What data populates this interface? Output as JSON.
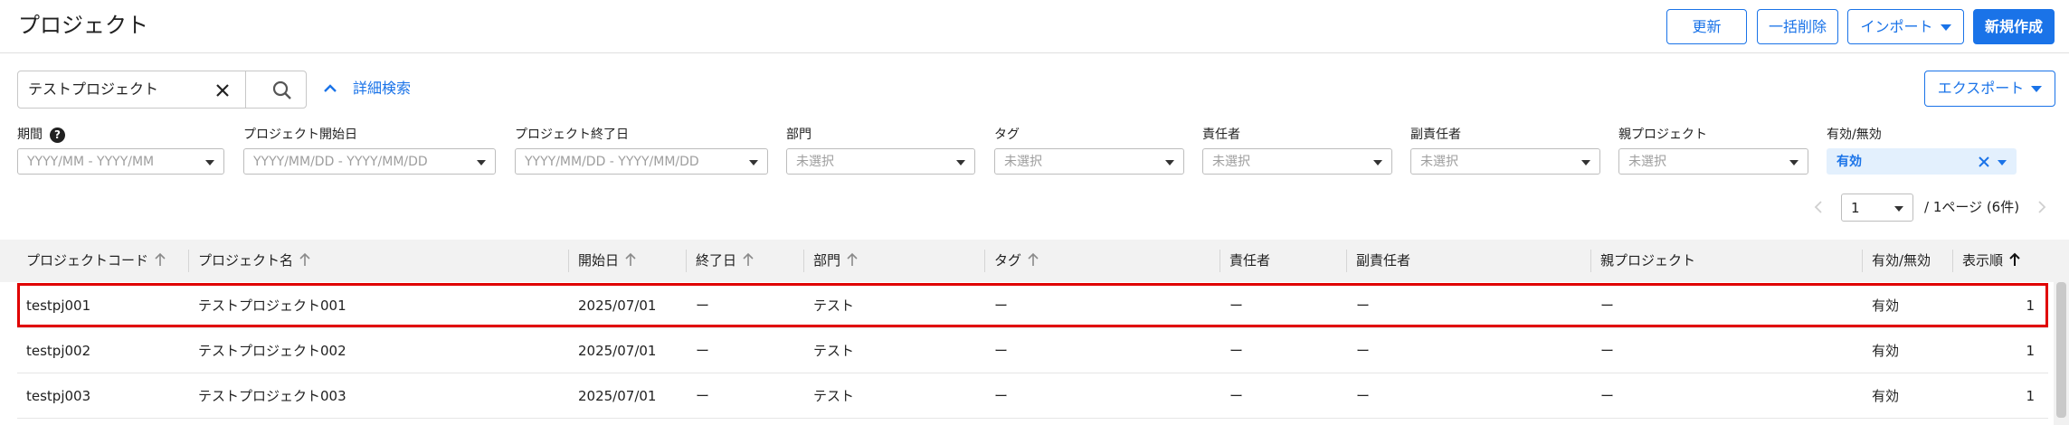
{
  "header": {
    "title": "プロジェクト",
    "buttons": {
      "refresh": "更新",
      "bulk_delete": "一括削除",
      "import": "インポート",
      "create": "新規作成"
    }
  },
  "search": {
    "value": "テストプロジェクト",
    "advanced_label": "詳細検索"
  },
  "export": {
    "label": "エクスポート"
  },
  "filters": {
    "period": {
      "label": "期間",
      "placeholder": "YYYY/MM - YYYY/MM"
    },
    "start_date": {
      "label": "プロジェクト開始日",
      "placeholder": "YYYY/MM/DD - YYYY/MM/DD"
    },
    "end_date": {
      "label": "プロジェクト終了日",
      "placeholder": "YYYY/MM/DD - YYYY/MM/DD"
    },
    "department": {
      "label": "部門",
      "placeholder": "未選択"
    },
    "tag": {
      "label": "タグ",
      "placeholder": "未選択"
    },
    "owner": {
      "label": "責任者",
      "placeholder": "未選択"
    },
    "sub_owner": {
      "label": "副責任者",
      "placeholder": "未選択"
    },
    "parent": {
      "label": "親プロジェクト",
      "placeholder": "未選択"
    },
    "status": {
      "label": "有効/無効",
      "value": "有効"
    }
  },
  "pagination": {
    "page": "1",
    "text": "/  1ページ (6件)"
  },
  "table": {
    "columns": {
      "code": "プロジェクトコード",
      "name": "プロジェクト名",
      "start": "開始日",
      "end": "終了日",
      "dept": "部門",
      "tag": "タグ",
      "owner": "責任者",
      "sub_owner": "副責任者",
      "parent": "親プロジェクト",
      "status": "有効/無効",
      "order": "表示順"
    },
    "rows": [
      {
        "code": "testpj001",
        "name": "テストプロジェクト001",
        "start": "2025/07/01",
        "end": "ー",
        "dept": "テスト",
        "tag": "ー",
        "owner": "ー",
        "sub_owner": "ー",
        "parent": "ー",
        "status": "有効",
        "order": "1"
      },
      {
        "code": "testpj002",
        "name": "テストプロジェクト002",
        "start": "2025/07/01",
        "end": "ー",
        "dept": "テスト",
        "tag": "ー",
        "owner": "ー",
        "sub_owner": "ー",
        "parent": "ー",
        "status": "有効",
        "order": "1"
      },
      {
        "code": "testpj003",
        "name": "テストプロジェクト003",
        "start": "2025/07/01",
        "end": "ー",
        "dept": "テスト",
        "tag": "ー",
        "owner": "ー",
        "sub_owner": "ー",
        "parent": "ー",
        "status": "有効",
        "order": "1"
      }
    ]
  },
  "colors": {
    "accent": "#1a73e8",
    "highlight_border": "#e00000",
    "header_bg": "#f2f2f2",
    "chip_bg": "#e3f0fd"
  }
}
